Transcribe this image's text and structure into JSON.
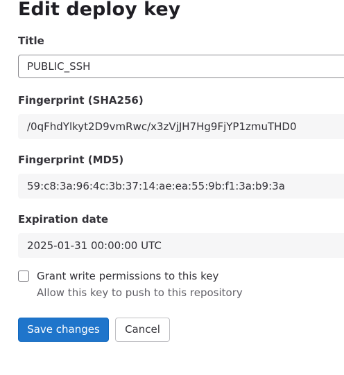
{
  "page": {
    "title": "Edit deploy key"
  },
  "form": {
    "title_label": "Title",
    "title_value": "PUBLIC_SSH",
    "sha256_label": "Fingerprint (SHA256)",
    "sha256_value": "/0qFhdYlkyt2D9vmRwc/x3zVjJH7Hg9FjYP1zmuTHD0",
    "md5_label": "Fingerprint (MD5)",
    "md5_value": "59:c8:3a:96:4c:3b:37:14:ae:ea:55:9b:f1:3a:b9:3a",
    "expiration_label": "Expiration date",
    "expiration_value": "2025-01-31 00:00:00 UTC",
    "write_access": {
      "label": "Grant write permissions to this key",
      "help": "Allow this key to push to this repository",
      "checked": false
    }
  },
  "actions": {
    "save_label": "Save changes",
    "cancel_label": "Cancel"
  },
  "colors": {
    "primary": "#1f75cb",
    "readonly_bg": "#f6f6f7",
    "text": "#333238"
  }
}
